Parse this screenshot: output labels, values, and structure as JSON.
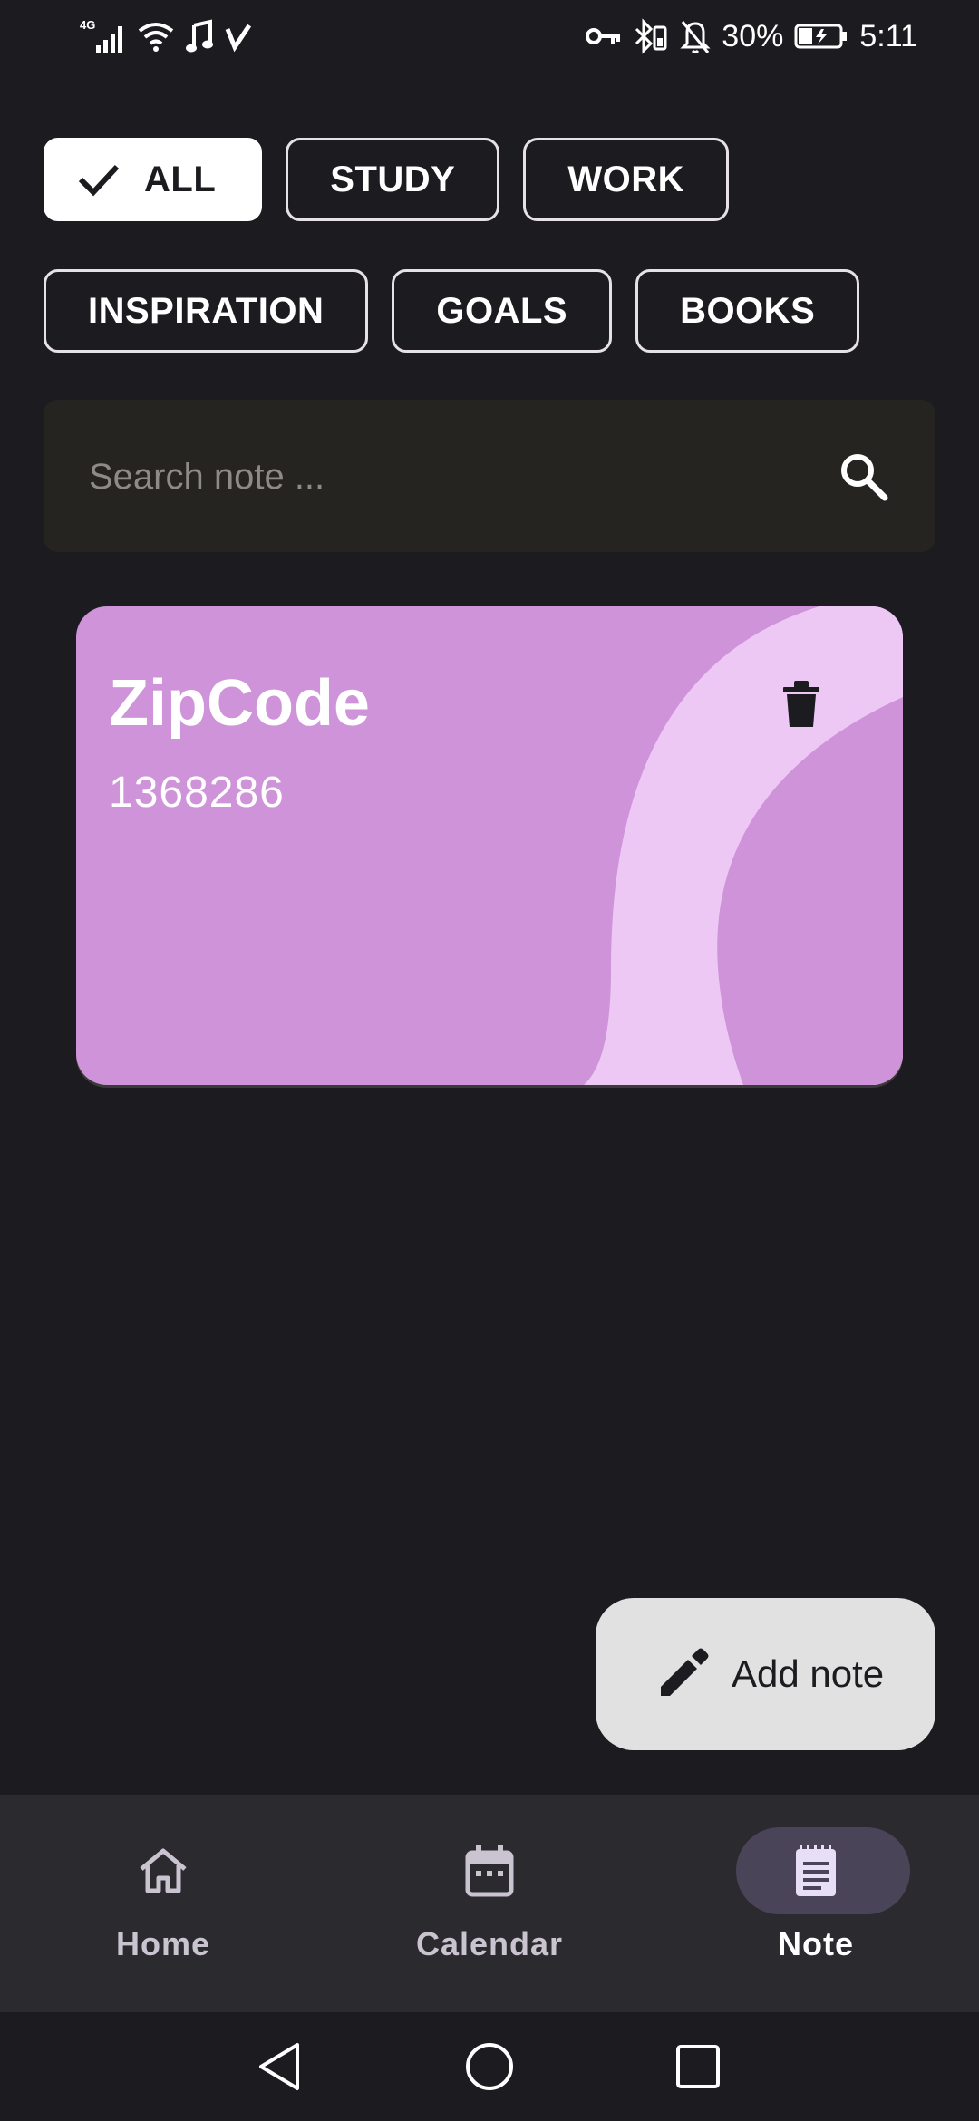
{
  "status_bar": {
    "network": "4G",
    "battery": "30%",
    "time": "5:11"
  },
  "filters": {
    "row1": [
      {
        "label": "ALL",
        "selected": true
      },
      {
        "label": "STUDY",
        "selected": false
      },
      {
        "label": "WORK",
        "selected": false
      }
    ],
    "row2": [
      {
        "label": "INSPIRATION",
        "selected": false
      },
      {
        "label": "GOALS",
        "selected": false
      },
      {
        "label": "BOOKS",
        "selected": false
      }
    ]
  },
  "search": {
    "placeholder": "Search note ...",
    "value": ""
  },
  "notes": [
    {
      "title": "ZipCode",
      "body": "1368286",
      "color": "#ce93d8"
    }
  ],
  "fab": {
    "label": "Add note",
    "icon": "pencil-icon"
  },
  "bottom_nav": {
    "items": [
      {
        "label": "Home",
        "icon": "home-icon",
        "active": false
      },
      {
        "label": "Calendar",
        "icon": "calendar-icon",
        "active": false
      },
      {
        "label": "Note",
        "icon": "note-icon",
        "active": true
      }
    ]
  },
  "colors": {
    "background": "#1c1b1f",
    "card": "#ce93d8",
    "card_accent": "#eec8f5",
    "nav_indicator": "#4a4458",
    "fab": "#e1e1e1"
  }
}
